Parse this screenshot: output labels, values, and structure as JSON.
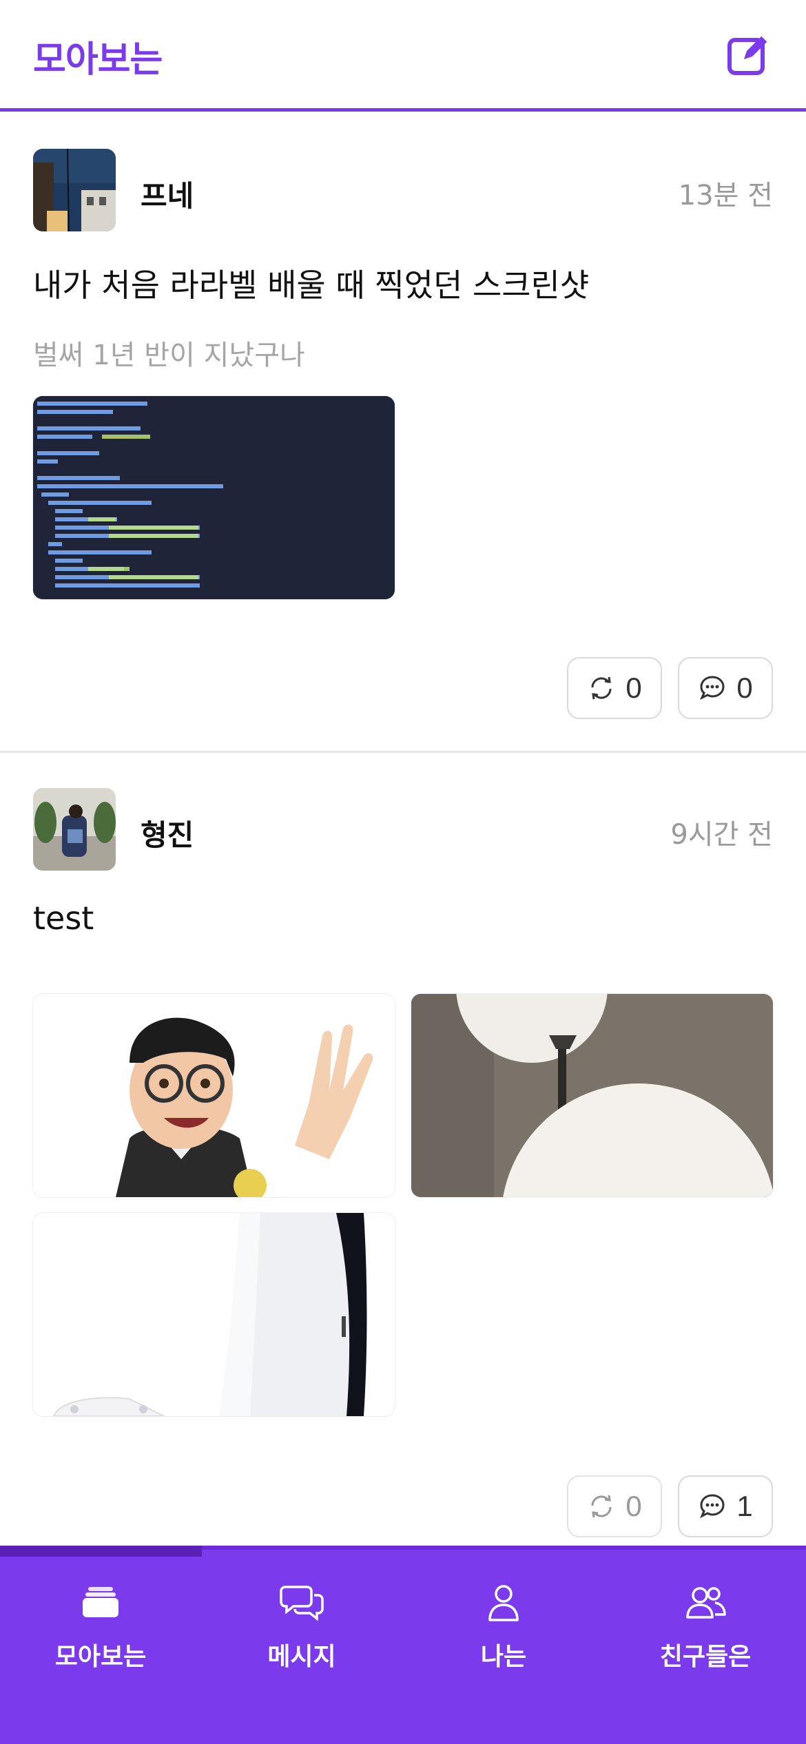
{
  "header": {
    "title": "모아보는"
  },
  "posts": [
    {
      "author": "프네",
      "time": "13분 전",
      "text": "내가 처음 라라벨 배울 때 찍었던 스크린샷",
      "subtext": "벌써 1년 반이 지났구나",
      "repost_count": "0",
      "comment_count": "0"
    },
    {
      "author": "형진",
      "time": "9시간 전",
      "text": "test",
      "repost_count": "0",
      "comment_count": "1"
    }
  ],
  "nav": {
    "items": [
      {
        "label": "모아보는",
        "icon": "cards-icon"
      },
      {
        "label": "메시지",
        "icon": "chat-bubbles-icon"
      },
      {
        "label": "나는",
        "icon": "user-icon"
      },
      {
        "label": "친구들은",
        "icon": "users-icon"
      }
    ]
  },
  "colors": {
    "accent": "#7c3aed",
    "accent_dark": "#5b21b6"
  }
}
